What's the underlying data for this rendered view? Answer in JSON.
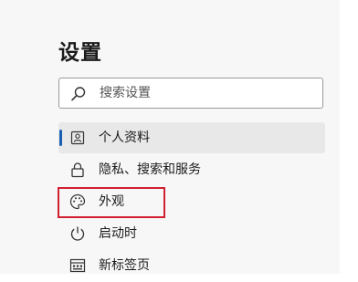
{
  "settings": {
    "title": "设置",
    "search": {
      "placeholder": "搜索设置",
      "value": "",
      "icon": "search-icon"
    },
    "nav": [
      {
        "label": "个人资料",
        "icon": "profile-icon",
        "selected": true
      },
      {
        "label": "隐私、搜索和服务",
        "icon": "lock-icon",
        "selected": false
      },
      {
        "label": "外观",
        "icon": "palette-icon",
        "selected": false,
        "highlighted": true
      },
      {
        "label": "启动时",
        "icon": "power-icon",
        "selected": false
      },
      {
        "label": "新标签页",
        "icon": "new-tab-icon",
        "selected": false
      }
    ],
    "colors": {
      "accent": "#1a5fb4",
      "highlight_border": "#d0202e",
      "panel_bg": "#f7f7f7",
      "selected_bg": "#e8e8e8"
    }
  }
}
